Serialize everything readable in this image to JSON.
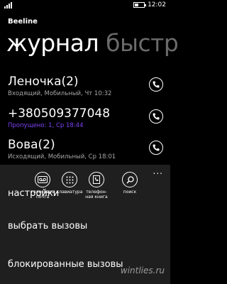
{
  "status_bar": {
    "time": "12:02"
  },
  "app": {
    "title": "Beeline"
  },
  "pivot": {
    "active": "журнал",
    "inactive": "быстр"
  },
  "calls": [
    {
      "name": "Леночка(2)",
      "detail": "Входящий, Мобильный, Чт 10:32",
      "missed": false
    },
    {
      "name": "+380509377048",
      "detail": "Пропущено: 1, Ср 18:44",
      "missed": true
    },
    {
      "name": "Вова(2)",
      "detail": "Исходящий, Мобильный, Ср 18:01",
      "missed": false
    }
  ],
  "app_bar": {
    "ellipsis": "...",
    "buttons": [
      {
        "label_line1": "голосовая",
        "label_line2": "почта",
        "icon": "voicemail-icon"
      },
      {
        "label_line1": "клавиатура",
        "label_line2": "",
        "icon": "keypad-icon"
      },
      {
        "label_line1": "телефон-",
        "label_line2": "ная книга",
        "icon": "contacts-book-icon"
      },
      {
        "label_line1": "поиск",
        "label_line2": "",
        "icon": "search-icon"
      }
    ],
    "menu": [
      "настройки",
      "выбрать вызовы",
      "блокированные вызовы"
    ]
  },
  "watermark": "wintlies.ru",
  "colors": {
    "background": "#000000",
    "app_bar": "#1f1f1f",
    "missed": "#7b42f6",
    "inactive_pivot": "#6b6b6b"
  }
}
